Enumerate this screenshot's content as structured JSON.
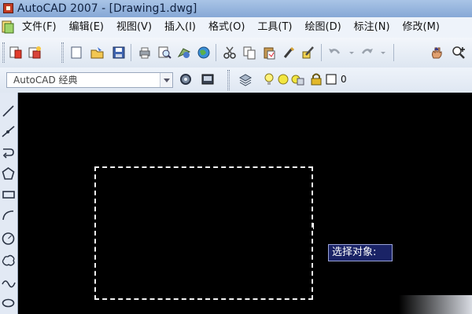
{
  "window": {
    "title": "AutoCAD 2007 - [Drawing1.dwg]"
  },
  "menu": {
    "items": [
      "文件(F)",
      "编辑(E)",
      "视图(V)",
      "插入(I)",
      "格式(O)",
      "工具(T)",
      "绘图(D)",
      "标注(N)",
      "修改(M)"
    ]
  },
  "workspace": {
    "current": "AutoCAD 经典"
  },
  "layer": {
    "current": "0"
  },
  "canvas": {
    "background": "#000000",
    "tooltip": "选择对象:"
  },
  "colors": {
    "title_bar": "#9db9e0",
    "toolbar_bg": "#e8eef7",
    "tooltip_bg": "#1a2366",
    "selection": "#f2f2f2"
  },
  "icons": {
    "standard_toolbar": [
      "new-sheet-set-icon",
      "publish-icon",
      "new-icon",
      "open-icon",
      "save-icon",
      "plot-icon",
      "plot-preview-icon",
      "publish-3d-icon",
      "web-icon",
      "cut-icon",
      "copy-icon",
      "paste-icon",
      "match-properties-icon",
      "block-editor-icon",
      "undo-icon",
      "redo-icon",
      "pan-icon",
      "zoom-realtime-icon"
    ],
    "draw_toolbar": [
      "line-icon",
      "construction-line-icon",
      "polyline-icon",
      "polygon-icon",
      "rectangle-icon",
      "arc-icon",
      "circle-icon",
      "revision-cloud-icon",
      "spline-icon",
      "ellipse-icon"
    ]
  }
}
